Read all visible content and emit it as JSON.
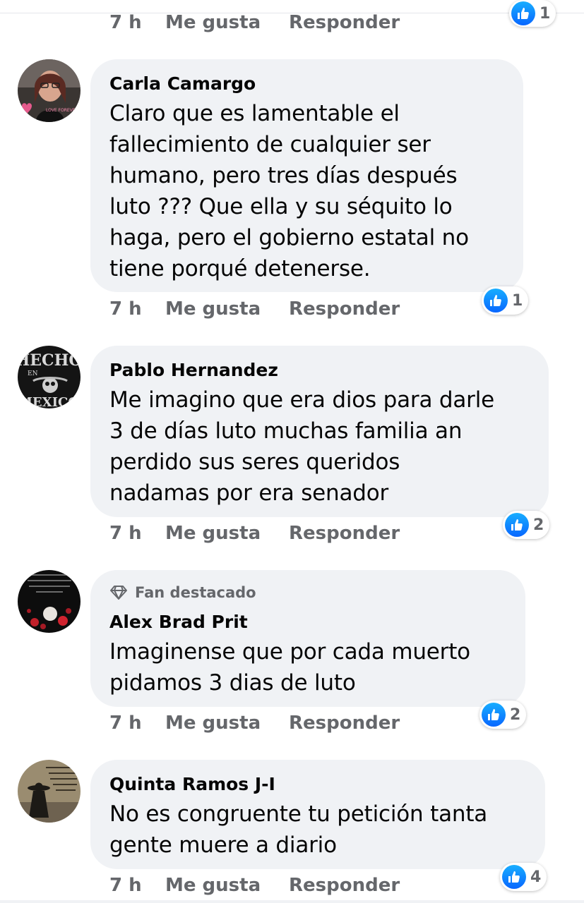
{
  "colors": {
    "bubble": "#f0f2f5",
    "meta_text": "#65676b",
    "like_blue": "#0866ff"
  },
  "icons": {
    "like": "thumbs-up-icon",
    "fan_badge": "diamond-icon"
  },
  "top_item": {
    "time": "7 h",
    "like_label": "Me gusta",
    "reply_label": "Responder",
    "reaction_count": "1"
  },
  "comments": [
    {
      "author": "Carla Camargo",
      "text_lines": [
        "Claro que es lamentable el",
        "fallecimiento de cualquier ser",
        "humano, pero tres días después",
        "luto ??? Que ella y su séquito lo",
        "haga, pero el gobierno estatal no",
        "tiene porqué detenerse."
      ],
      "reaction_count": "1",
      "time": "7 h",
      "like_label": "Me gusta",
      "reply_label": "Responder"
    },
    {
      "author": "Pablo Hernandez",
      "text_lines": [
        "Me imagino que era dios para darle",
        "3 de días luto muchas familia an",
        "perdido sus seres queridos",
        "nadamas por era senador"
      ],
      "reaction_count": "2",
      "time": "7 h",
      "like_label": "Me gusta",
      "reply_label": "Responder"
    },
    {
      "badge": "Fan destacado",
      "author": "Alex Brad Prit",
      "text_lines": [
        "Imaginense que por cada muerto",
        "pidamos 3 dias de luto"
      ],
      "reaction_count": "2",
      "time": "7 h",
      "like_label": "Me gusta",
      "reply_label": "Responder"
    },
    {
      "author": "Quinta Ramos J-I",
      "text_lines": [
        "No es congruente tu petición tanta",
        "gente muere a diario"
      ],
      "reaction_count": "4",
      "time": "7 h",
      "like_label": "Me gusta",
      "reply_label": "Responder"
    }
  ]
}
